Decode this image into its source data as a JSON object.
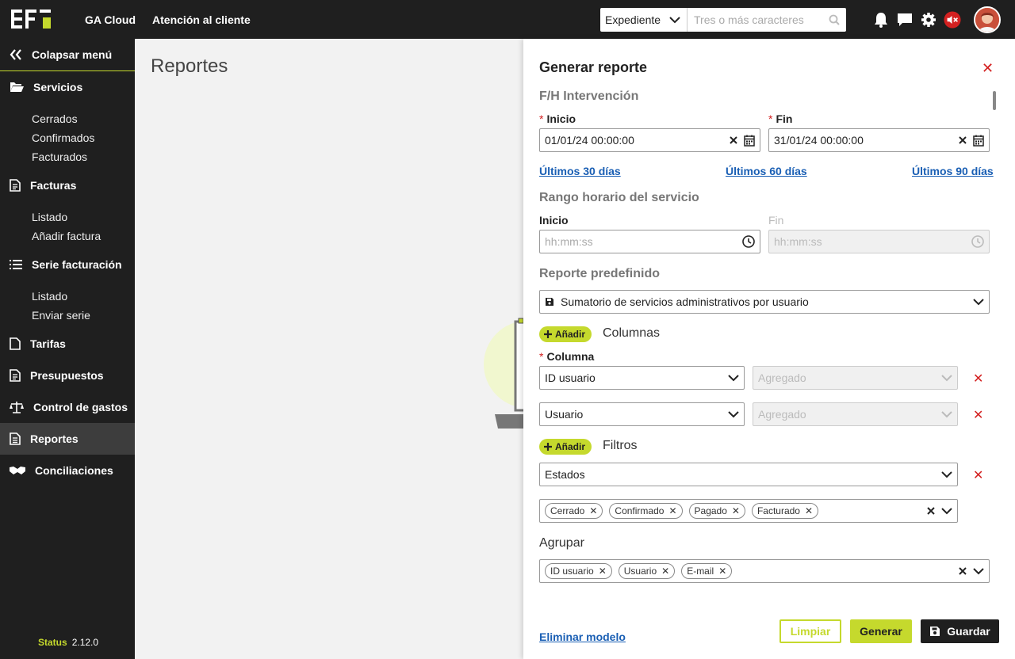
{
  "topbar": {
    "nav": [
      "GA Cloud",
      "Atención al cliente"
    ],
    "search_select": "Expediente",
    "search_placeholder": "Tres o más caracteres"
  },
  "sidebar": {
    "collapse": "Colapsar menú",
    "sections": [
      {
        "label": "Servicios",
        "icon": "folder-open-icon",
        "items": [
          "Cerrados",
          "Confirmados",
          "Facturados"
        ]
      },
      {
        "label": "Facturas",
        "icon": "document-icon",
        "items": [
          "Listado",
          "Añadir factura"
        ]
      },
      {
        "label": "Serie facturación",
        "icon": "list-icon",
        "items": [
          "Listado",
          "Enviar serie"
        ]
      },
      {
        "label": "Tarifas",
        "icon": "file-icon",
        "items": []
      },
      {
        "label": "Presupuestos",
        "icon": "document-icon",
        "items": []
      },
      {
        "label": "Control de gastos",
        "icon": "scale-icon",
        "items": []
      },
      {
        "label": "Reportes",
        "icon": "report-icon",
        "items": [],
        "active": true
      },
      {
        "label": "Conciliaciones",
        "icon": "handshake-icon",
        "items": []
      }
    ],
    "status_label": "Status",
    "version": "2.12.0"
  },
  "main": {
    "title": "Reportes"
  },
  "panel": {
    "title": "Generar reporte",
    "intervencion": {
      "title": "F/H Intervención",
      "inicio_label": "Inicio",
      "fin_label": "Fin",
      "inicio_value": "01/01/24 00:00:00",
      "fin_value": "31/01/24 00:00:00",
      "quick": [
        "Últimos 30 días",
        "Últimos 60 días",
        "Últimos 90 días"
      ]
    },
    "rango": {
      "title": "Rango horario del servicio",
      "inicio_label": "Inicio",
      "fin_label": "Fin",
      "placeholder": "hh:mm:ss"
    },
    "predefinido": {
      "title": "Reporte predefinido",
      "value": "Sumatorio de servicios administrativos por usuario"
    },
    "columnas": {
      "add": "Añadir",
      "title": "Columnas",
      "column_label": "Columna",
      "rows": [
        {
          "value": "ID usuario",
          "agg": "Agregado"
        },
        {
          "value": "Usuario",
          "agg": "Agregado"
        }
      ]
    },
    "filtros": {
      "add": "Añadir",
      "title": "Filtros",
      "field": "Estados",
      "chips": [
        "Cerrado",
        "Confirmado",
        "Pagado",
        "Facturado"
      ]
    },
    "agrupar": {
      "title": "Agrupar",
      "chips": [
        "ID usuario",
        "Usuario",
        "E-mail"
      ]
    },
    "footer": {
      "delete_link": "Eliminar modelo",
      "clear": "Limpiar",
      "generate": "Generar",
      "save": "Guardar"
    }
  }
}
